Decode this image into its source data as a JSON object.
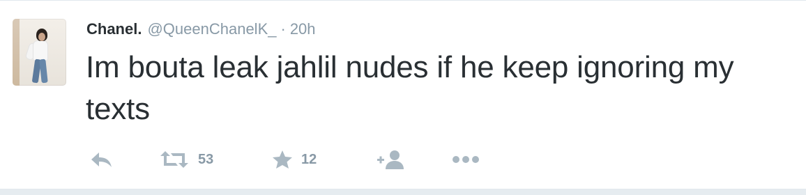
{
  "tweet": {
    "name": "Chanel.",
    "handle": "@QueenChanelK_",
    "separator": "·",
    "time": "20h",
    "text": "Im bouta leak jahlil nudes if he keep ignoring my texts"
  },
  "actions": {
    "reply_icon": "reply-arrow-icon",
    "retweet_icon": "retweet-icon",
    "retweet_count": "53",
    "favorite_icon": "star-icon",
    "favorite_count": "12",
    "follow_icon": "add-follow-icon",
    "more_icon": "ellipsis-icon"
  },
  "colors": {
    "text": "#292f33",
    "secondary": "#8899a6",
    "icon": "#aab8c2",
    "border": "#e1e8ed"
  }
}
